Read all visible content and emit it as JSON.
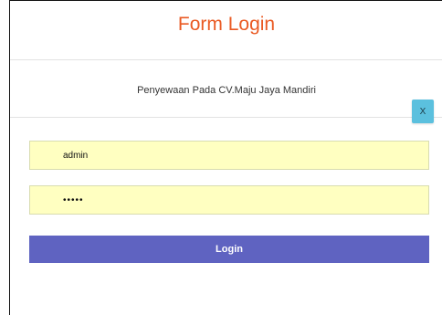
{
  "form": {
    "title": "Form Login",
    "subtitle": "Penyewaan Pada CV.Maju Jaya Mandiri",
    "close_label": "X",
    "username_value": "admin",
    "password_value": "admin",
    "login_label": "Login"
  },
  "colors": {
    "title": "#ea5a23",
    "input_background": "#ffffc1",
    "close_button": "#5bc0de",
    "login_button": "#5f63c1"
  }
}
